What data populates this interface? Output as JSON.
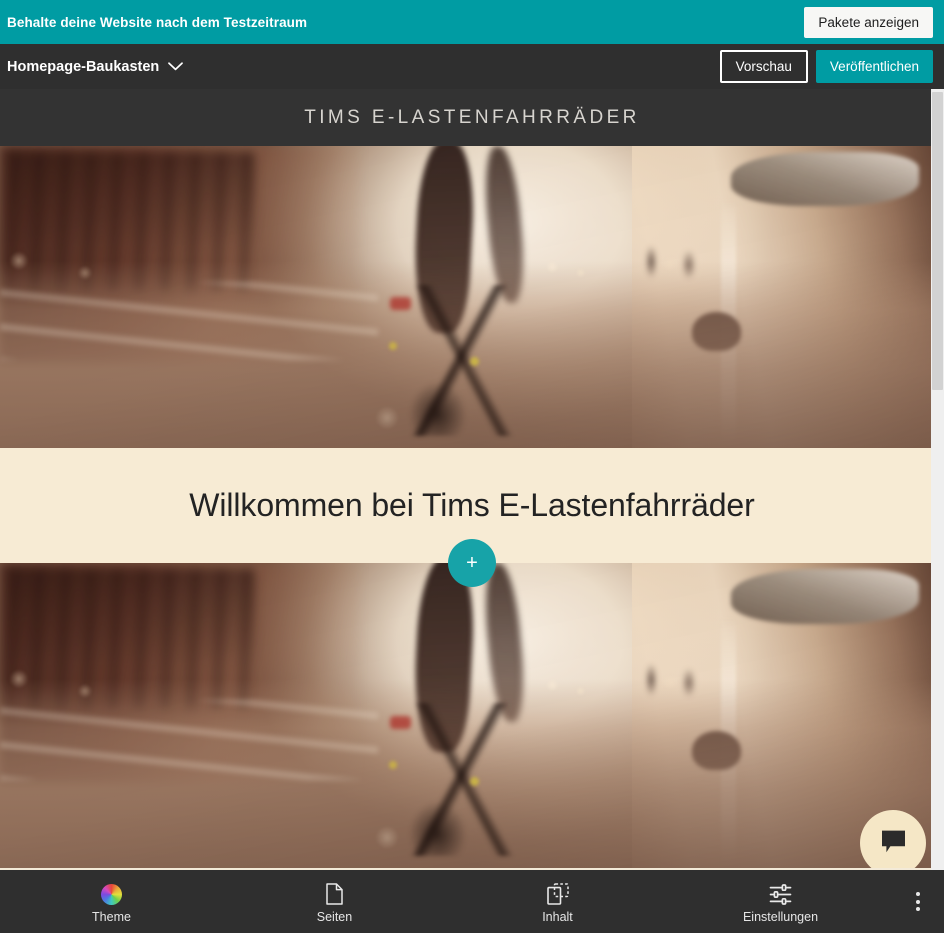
{
  "trial_banner": {
    "message": "Behalte deine Website nach dem Testzeitraum",
    "cta_label": "Pakete anzeigen",
    "background_color": "#009CA3",
    "text_color": "#FFFFFF"
  },
  "editor_bar": {
    "builder_label": "Homepage-Baukasten",
    "dropdown_icon": "chevron-down-icon",
    "preview_label": "Vorschau",
    "publish_label": "Veröffentlichen",
    "background_color": "#2F2F2F",
    "publish_color": "#009CA3"
  },
  "site_preview": {
    "header": {
      "title": "TIMS E-LASTENFAHRRÄDER",
      "background_color": "#333333",
      "text_color": "#D7D4CF"
    },
    "hero_top": {
      "alt": "Radfahrer bei Sonnenuntergang neben einem Auto in der Stadt"
    },
    "welcome_section": {
      "heading": "Willkommen bei Tims E-Lastenfahrräder",
      "background_color": "#F7EBD4",
      "text_color": "#232323"
    },
    "add_section_button": {
      "label": "+",
      "icon": "plus-icon",
      "color": "#17A3A8"
    },
    "hero_bottom": {
      "alt": "Radfahrer bei Sonnenuntergang neben einem Auto in der Stadt"
    },
    "chat_widget": {
      "icon": "chat-bubble-icon",
      "background_color": "#F5E7C6",
      "icon_color": "#2B2B2B"
    }
  },
  "bottom_toolbar": {
    "background_color": "#2F2F2F",
    "items": [
      {
        "label": "Theme",
        "icon": "color-wheel-icon"
      },
      {
        "label": "Seiten",
        "icon": "page-icon"
      },
      {
        "label": "Inhalt",
        "icon": "content-blocks-icon"
      },
      {
        "label": "Einstellungen",
        "icon": "sliders-icon"
      }
    ],
    "more_icon": "more-vertical-icon"
  },
  "scrollbar": {
    "orientation": "vertical",
    "track_color": "#EFEFEF",
    "thumb_color": "#D2D2D2"
  }
}
